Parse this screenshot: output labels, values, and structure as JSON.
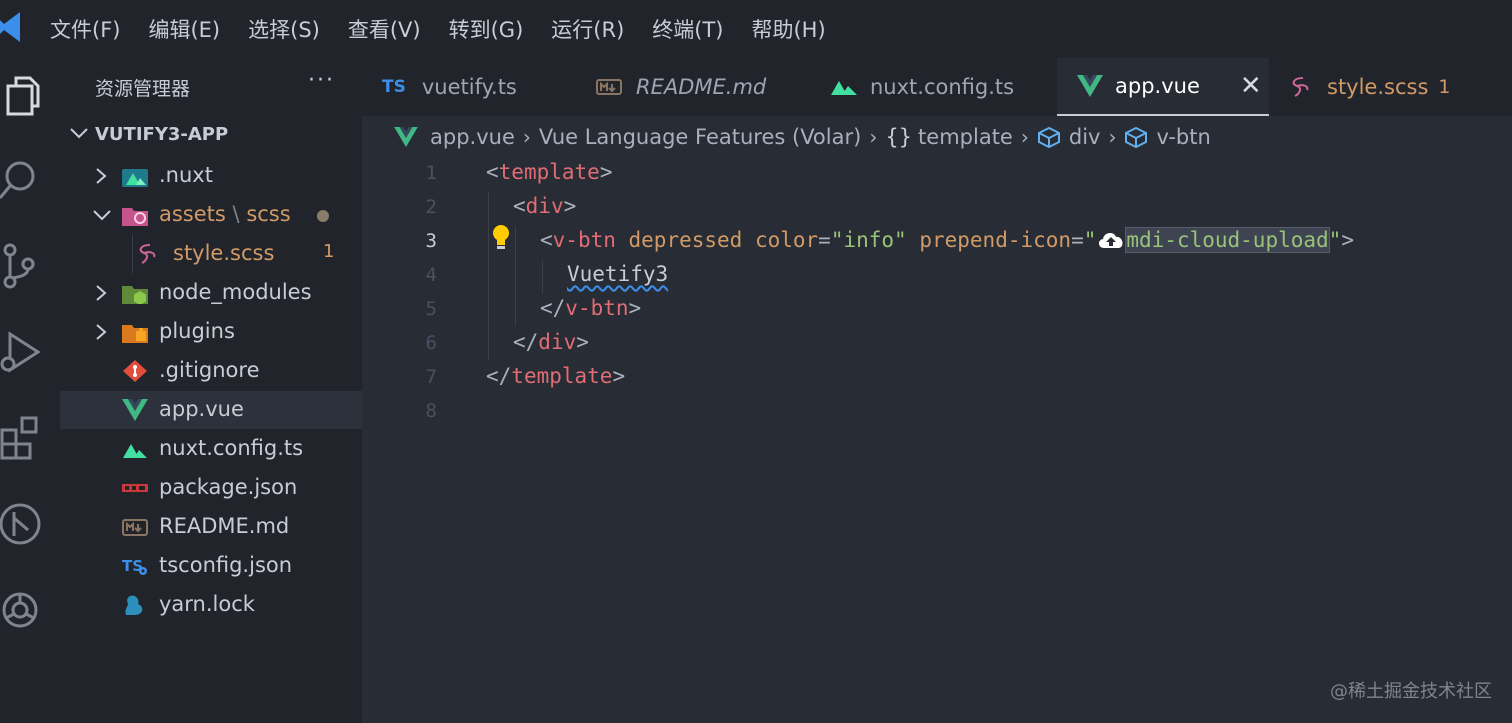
{
  "menu": [
    "文件(F)",
    "编辑(E)",
    "选择(S)",
    "查看(V)",
    "转到(G)",
    "运行(R)",
    "终端(T)",
    "帮助(H)"
  ],
  "explorer": {
    "title": "资源管理器",
    "more": "···",
    "root": "VUTIFY3-APP",
    "items": [
      {
        "label": ".nuxt"
      },
      {
        "label": "assets",
        "sep": "\\",
        "label2": "scss"
      },
      {
        "label": "style.scss",
        "badge": "1"
      },
      {
        "label": "node_modules"
      },
      {
        "label": "plugins"
      },
      {
        "label": ".gitignore"
      },
      {
        "label": "app.vue"
      },
      {
        "label": "nuxt.config.ts"
      },
      {
        "label": "package.json"
      },
      {
        "label": "README.md"
      },
      {
        "label": "tsconfig.json"
      },
      {
        "label": "yarn.lock"
      }
    ]
  },
  "tabs": [
    {
      "label": "vuetify.ts",
      "icon": "ts-icon"
    },
    {
      "label": "README.md",
      "icon": "markdown-icon"
    },
    {
      "label": "nuxt.config.ts",
      "icon": "nuxt-icon"
    },
    {
      "label": "app.vue",
      "icon": "vue-icon",
      "close": "✕"
    },
    {
      "label": "style.scss",
      "icon": "sass-icon",
      "badge": "1"
    }
  ],
  "breadcrumb": [
    "app.vue",
    "Vue Language Features (Volar)",
    "template",
    "div",
    "v-btn"
  ],
  "editor": {
    "line_numbers": [
      "1",
      "2",
      "3",
      "4",
      "5",
      "6",
      "7",
      "8"
    ],
    "current_line": 3,
    "lines": {
      "l1_open": "<",
      "l1_tag": "template",
      "l1_close": ">",
      "l2_open": "<",
      "l2_tag": "div",
      "l2_close": ">",
      "l3_open": "<",
      "l3_tag": "v-btn",
      "l3_attr1": " depressed ",
      "l3_attr2": "color",
      "l3_eq1": "=",
      "l3_val1": "\"info\"",
      "l3_attr3": " prepend-icon",
      "l3_eq2": "=",
      "l3_q1": "\"",
      "l3_val2": "mdi-cloud-upload",
      "l3_q2": "\"",
      "l3_close": ">",
      "l4_text": "Vuetify3",
      "l5_open": "</",
      "l5_tag": "v-btn",
      "l5_close": ">",
      "l6_open": "</",
      "l6_tag": "div",
      "l6_close": ">",
      "l7_open": "</",
      "l7_tag": "template",
      "l7_close": ">"
    }
  },
  "watermark": "@稀土掘金技术社区",
  "colors": {
    "tag": "#e06c75",
    "attr": "#d19a66",
    "string": "#98c379",
    "background": "#282c34",
    "sidebar": "#21252b"
  }
}
